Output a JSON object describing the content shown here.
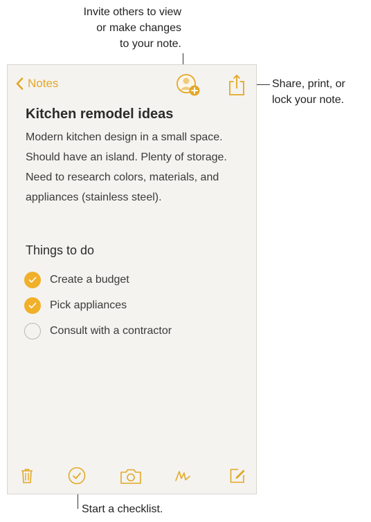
{
  "callouts": {
    "invite": "Invite others to view\nor make changes\nto your note.",
    "share": "Share, print, or\nlock your note.",
    "checklist": "Start a checklist."
  },
  "nav": {
    "back_label": "Notes",
    "back_icon": "chevron-left-icon",
    "collaborate_icon": "add-person-icon",
    "share_icon": "share-icon"
  },
  "note": {
    "title": "Kitchen remodel ideas",
    "body": "Modern kitchen design in a small space. Should have an island. Plenty of storage. Need to research colors, materials, and appliances (stainless steel).",
    "subtitle": "Things to do",
    "checklist": [
      {
        "label": "Create a budget",
        "checked": true
      },
      {
        "label": "Pick appliances",
        "checked": true
      },
      {
        "label": "Consult with a contractor",
        "checked": false
      }
    ]
  },
  "toolbar": {
    "icons": [
      "trash-icon",
      "checklist-icon",
      "camera-icon",
      "sketch-icon",
      "compose-icon"
    ]
  },
  "colors": {
    "accent": "#e3a727",
    "check_fill": "#f1b02a",
    "paper": "#f4f3ef"
  }
}
